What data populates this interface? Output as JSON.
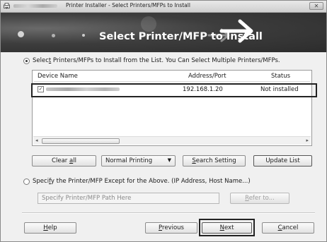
{
  "window": {
    "title": "Printer Installer - Select Printers/MFPs to Install",
    "close_glyph": "✕"
  },
  "banner": {
    "title": "Select Printer/MFP to Install"
  },
  "select_from_list": {
    "label_before": "Selec",
    "accel": "t",
    "label_after": " Printers/MFPs to Install from the List. You Can Select Multiple Printers/MFPs.",
    "checked": true
  },
  "device_list": {
    "columns": [
      "Device Name",
      "Address/Port",
      "Status"
    ],
    "rows": [
      {
        "checked": true,
        "address": "192.168.1.20",
        "status": "Not installed"
      }
    ]
  },
  "actions": {
    "clear_all_prefix": "Clear ",
    "clear_all_accel": "a",
    "clear_all_suffix": "ll",
    "printing_mode": "Normal Printing",
    "search_setting_accel": "S",
    "search_setting_rest": "earch Setting",
    "update_list": "Update List"
  },
  "specify_other": {
    "label_before": "Speci",
    "accel": "f",
    "label_after": "y the Printer/MFP Except for the Above. (IP Address, Host Name...)",
    "checked": false,
    "path_placeholder": "Specify Printer/MFP Path Here",
    "refer_accel": "R",
    "refer_rest": "efer to..."
  },
  "footer": {
    "help_accel": "H",
    "help_rest": "elp",
    "previous_accel": "P",
    "previous_rest": "revious",
    "next_accel": "N",
    "next_rest": "ext",
    "cancel_accel": "C",
    "cancel_rest": "ancel"
  },
  "icons": {
    "app": "printer-installer-icon",
    "close": "close-icon",
    "banner_arrow": "arrow-right-icon",
    "dropdown": "chevron-down-icon",
    "scroll_left": "scroll-left-icon",
    "scroll_right": "scroll-right-icon"
  }
}
